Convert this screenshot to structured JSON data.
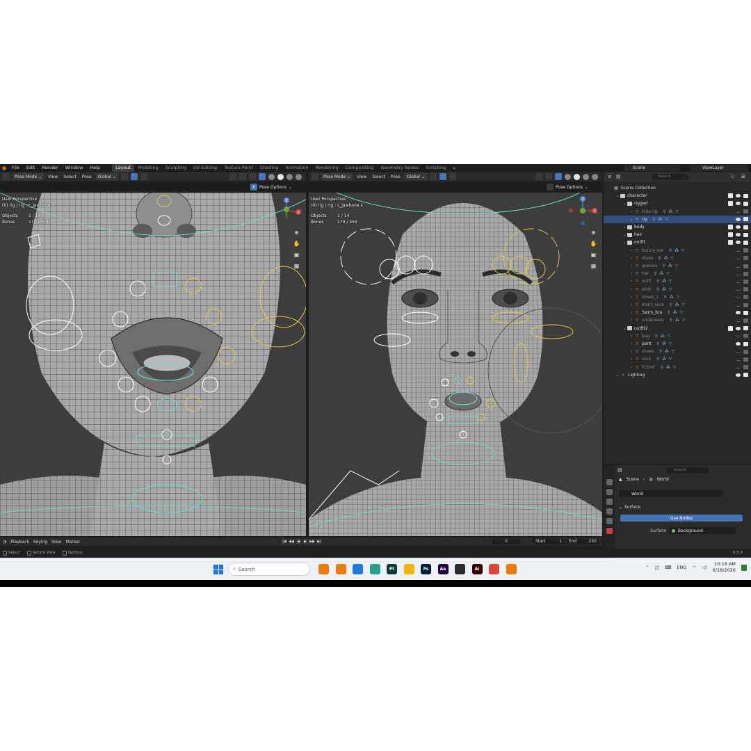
{
  "menubar": {
    "menus": [
      "File",
      "Edit",
      "Render",
      "Window",
      "Help"
    ],
    "workspaces": [
      "Layout",
      "Modeling",
      "Sculpting",
      "UV Editing",
      "Texture Paint",
      "Shading",
      "Animation",
      "Rendering",
      "Compositing",
      "Geometry Nodes",
      "Scripting"
    ],
    "active_workspace": "Layout",
    "scene": "Scene",
    "view_layer": "ViewLayer"
  },
  "viewport_left": {
    "mode": "Pose Mode",
    "menus": [
      "View",
      "Select",
      "Pose"
    ],
    "orientation": "Global",
    "pose_options": "Pose Options",
    "x_label": "X",
    "info": {
      "perspective": "User Perspective",
      "object": "(0) rig | rig : c_jawbone.x",
      "objects_label": "Objects",
      "objects_value": "1 / 14",
      "bones_label": "Bones",
      "bones_value": "179 / 559"
    }
  },
  "viewport_right": {
    "mode": "Pose Mode",
    "menus": [
      "View",
      "Select",
      "Pose"
    ],
    "orientation": "Global",
    "pose_options": "Pose Options",
    "info": {
      "perspective": "User Perspective",
      "object": "(0) rig | rig : c_jawbone.x",
      "objects_label": "Objects",
      "objects_value": "1 / 14",
      "bones_label": "Bones",
      "bones_value": "179 / 559"
    }
  },
  "gizmo": {
    "z": "Z",
    "x": "X",
    "y": "Y"
  },
  "outliner": {
    "search_placeholder": "Search",
    "rows": [
      {
        "label": "Scene Collection",
        "kind": "root",
        "depth": 0,
        "dim": false,
        "sel": false
      },
      {
        "label": "character",
        "kind": "coll",
        "depth": 1,
        "dim": false,
        "sel": false
      },
      {
        "label": "rigged",
        "kind": "coll",
        "depth": 2,
        "dim": false,
        "sel": false
      },
      {
        "label": "hide rig",
        "kind": "obj",
        "depth": 3,
        "dim": true,
        "sel": false
      },
      {
        "label": "rig",
        "kind": "rig",
        "depth": 3,
        "dim": false,
        "sel": true
      },
      {
        "label": "body",
        "kind": "coll",
        "depth": 2,
        "dim": false,
        "sel": false
      },
      {
        "label": "hair",
        "kind": "coll",
        "depth": 2,
        "dim": false,
        "sel": false
      },
      {
        "label": "outfit",
        "kind": "coll",
        "depth": 2,
        "dim": false,
        "sel": false
      },
      {
        "label": "bunny_ear",
        "kind": "obj",
        "depth": 3,
        "dim": true,
        "sel": false
      },
      {
        "label": "dress",
        "kind": "obj",
        "depth": 3,
        "dim": true,
        "sel": false
      },
      {
        "label": "glasses",
        "kind": "obj",
        "depth": 3,
        "dim": true,
        "sel": false
      },
      {
        "label": "hat",
        "kind": "obj",
        "depth": 3,
        "dim": true,
        "sel": false
      },
      {
        "label": "outfi",
        "kind": "obj",
        "depth": 3,
        "dim": true,
        "sel": false
      },
      {
        "label": "shirt",
        "kind": "obj",
        "depth": 3,
        "dim": true,
        "sel": false
      },
      {
        "label": "shoes_1",
        "kind": "obj",
        "depth": 3,
        "dim": true,
        "sel": false
      },
      {
        "label": "short_sock",
        "kind": "obj",
        "depth": 3,
        "dim": true,
        "sel": false
      },
      {
        "label": "Swim_bra",
        "kind": "obj",
        "depth": 3,
        "dim": false,
        "sel": false
      },
      {
        "label": "underwear",
        "kind": "obj",
        "depth": 3,
        "dim": true,
        "sel": false
      },
      {
        "label": "outfit2",
        "kind": "coll",
        "depth": 2,
        "dim": false,
        "sel": false
      },
      {
        "label": "bag",
        "kind": "obj",
        "depth": 3,
        "dim": true,
        "sel": false
      },
      {
        "label": "pant",
        "kind": "obj",
        "depth": 3,
        "dim": false,
        "sel": false
      },
      {
        "label": "shoes",
        "kind": "obj",
        "depth": 3,
        "dim": true,
        "sel": false
      },
      {
        "label": "sock",
        "kind": "obj",
        "depth": 3,
        "dim": true,
        "sel": false
      },
      {
        "label": "T-Shirt",
        "kind": "obj",
        "depth": 3,
        "dim": true,
        "sel": false
      },
      {
        "label": "Lighting",
        "kind": "light",
        "depth": 1,
        "dim": false,
        "sel": false
      }
    ]
  },
  "properties": {
    "search_placeholder": "Search",
    "breadcrumb_scene": "Scene",
    "breadcrumb_world": "World",
    "world_name": "World",
    "surface_panel": "Surface",
    "use_nodes": "Use Nodes",
    "surface_label": "Surface",
    "surface_value": "Background"
  },
  "timeline": {
    "menus": [
      "Playback",
      "Keying",
      "View",
      "Marker"
    ],
    "current_frame": "0",
    "start_label": "Start",
    "start_value": "1",
    "end_label": "End",
    "end_value": "250"
  },
  "statusbar": {
    "select": "Select",
    "rotate": "Rotate View",
    "options": "Options",
    "version": "4.5.6"
  },
  "taskbar": {
    "search_placeholder": "Search",
    "apps": [
      {
        "name": "blender-app",
        "label": "",
        "color": "#e87d0d"
      },
      {
        "name": "blender-app-2",
        "label": "",
        "color": "#e87d0d"
      },
      {
        "name": "store-app",
        "label": "",
        "color": "#1f7ae0"
      },
      {
        "name": "edge-app",
        "label": "",
        "color": "#2a9d8f"
      },
      {
        "name": "pt-app",
        "label": "Pt",
        "color": "#0f3d2e"
      },
      {
        "name": "explorer-app",
        "label": "",
        "color": "#f2b705"
      },
      {
        "name": "ps-app",
        "label": "Ps",
        "color": "#001e36"
      },
      {
        "name": "ae-app",
        "label": "Ae",
        "color": "#1f0040"
      },
      {
        "name": "zbrush-app",
        "label": "",
        "color": "#2b2b2b"
      },
      {
        "name": "ai-app",
        "label": "Ai",
        "color": "#330000"
      },
      {
        "name": "chrome-app",
        "label": "",
        "color": "#db4437"
      },
      {
        "name": "blender-app-3",
        "label": "",
        "color": "#e87d0d"
      }
    ],
    "language": "ENG",
    "time": "10:18 AM",
    "date": "6/18/2026"
  },
  "colors": {
    "accent_blue": "#4772b3",
    "blender_orange": "#e87d0d",
    "bone_cyan": "#6fd6d0",
    "bone_yellow": "#e6c84a"
  }
}
